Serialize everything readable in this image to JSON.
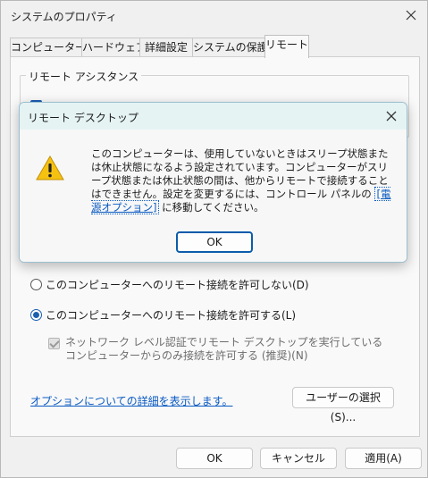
{
  "window": {
    "title": "システムのプロパティ"
  },
  "tabs": [
    {
      "label": "コンピューター名"
    },
    {
      "label": "ハードウェア"
    },
    {
      "label": "詳細設定"
    },
    {
      "label": "システムの保護"
    },
    {
      "label": "リモート"
    }
  ],
  "remote": {
    "assistance_legend": "リモート アシスタンス",
    "radio_disallow": "このコンピューターへのリモート接続を許可しない(D)",
    "radio_allow": "このコンピューターへのリモート接続を許可する(L)",
    "selected_radio": "allow",
    "nla_label": "ネットワーク レベル認証でリモート デスクトップを実行しているコンピューターからのみ接続を許可する (推奨)(N)",
    "nla_checked": true,
    "options_link": "オプションについての詳細を表示します。",
    "select_users_button": "ユーザーの選択(S)..."
  },
  "footer": {
    "ok": "OK",
    "cancel": "キャンセル",
    "apply": "適用(A)"
  },
  "dialog": {
    "title": "リモート デスクトップ",
    "message_before": "このコンピューターは、使用していないときはスリープ状態または休止状態になるよう設定されています。コンピューターがスリープ状態または休止状態の間は、他からリモートで接続することはできません。設定を変更するには、コントロール パネルの ",
    "link_text": "[電源オプション]",
    "message_after": " に移動してください。",
    "ok": "OK",
    "icon": "warning-icon"
  },
  "colors": {
    "accent": "#1b5eb1",
    "link": "#0a5ac2",
    "dialog_titlebar": "#e5f3f3"
  }
}
